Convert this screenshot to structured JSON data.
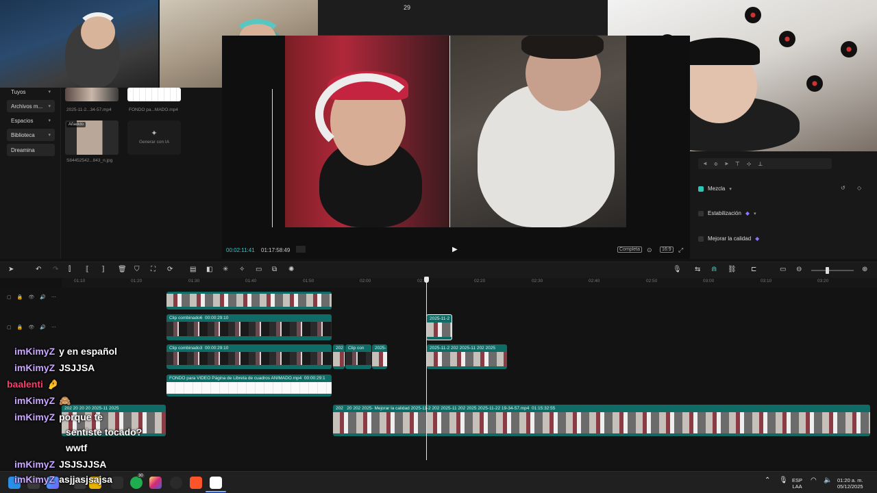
{
  "preview": {
    "frame_counter": "29"
  },
  "left_nav": {
    "items": [
      {
        "label": "Tuyos",
        "name": "nav-item-tuyos"
      },
      {
        "label": "Archivos m...",
        "name": "nav-item-archivos"
      },
      {
        "label": "Espacios",
        "name": "nav-item-espacios"
      },
      {
        "label": "Biblioteca",
        "name": "nav-item-biblioteca"
      },
      {
        "label": "Dreamina",
        "name": "nav-item-dreamina"
      }
    ]
  },
  "media": {
    "items": [
      {
        "caption": "2025-11-2...34-57.mp4"
      },
      {
        "caption": "FONDO pa...MADO.mp4"
      },
      {
        "caption": "S84452542...843_n.jpg",
        "badge": "Añadido"
      }
    ],
    "generate_label": "Generar con IA"
  },
  "player": {
    "current_time": "00:02:11:41",
    "total_time": "01:17:58:49",
    "controls": {
      "fit": "Completa",
      "ratio": "16:9"
    }
  },
  "inspector": {
    "blend_label": "Mezcla",
    "stabilization_label": "Estabilización",
    "enhance_label": "Mejorar la calidad"
  },
  "ruler": {
    "ticks": [
      "01:10",
      "01:20",
      "01:30",
      "01:40",
      "01:50",
      "02:00",
      "02:10",
      "02:20",
      "02:30",
      "02:40",
      "02:50",
      "03:00",
      "03:10",
      "03:20"
    ]
  },
  "clips": {
    "combined6": "Clip combinado6",
    "combined6_dur": "00:00:29:10",
    "combined3": "Clip combinado3",
    "combined3_dur": "00:00:29:10",
    "short1": "2025-11-2",
    "background": "FONDO para VIDEO Página de Libreta de cuadros ANIMADO.mp4",
    "background_dur": "00:00:29:1",
    "short2": "2025-11-2",
    "short3": "202",
    "short4": "2025-11",
    "short5": "202",
    "short6": "2025",
    "clip_con": "Clip con",
    "main": "2025-11-22 19-34-57.mp4",
    "main_dur": "01:15:32:55",
    "enhance": "Mejorar la calidad",
    "s_2025": "2025",
    "s_202": "20",
    "s_2025b": "2025-"
  },
  "chat": {
    "lines": [
      {
        "user": "imKimyZ",
        "msg": "y en español"
      },
      {
        "user": "imKimyZ",
        "msg": "JSJJSA"
      },
      {
        "user": "baalenti",
        "msg": "🤌"
      },
      {
        "user": "imKimyZ",
        "msg": "🙈"
      },
      {
        "user": "imKimyZ",
        "msg": "porque te"
      },
      {
        "user": "",
        "msg": "sentiste tocado?"
      },
      {
        "user": "",
        "msg": "wwtf"
      },
      {
        "user": "imKimyZ",
        "msg": "JSJSJJSA"
      },
      {
        "user": "imKimyZ",
        "msg": "asjjasjsajsa"
      }
    ]
  },
  "taskbar": {
    "whatsapp_badge": "30",
    "lang": "ESP",
    "lang_sub": "LAA",
    "time": "01:20 a. m.",
    "date": "05/12/2025"
  },
  "colors": {
    "accent": "#2ec4b6",
    "clip": "#0f6b66",
    "chat_user": "#c9a6ff"
  }
}
